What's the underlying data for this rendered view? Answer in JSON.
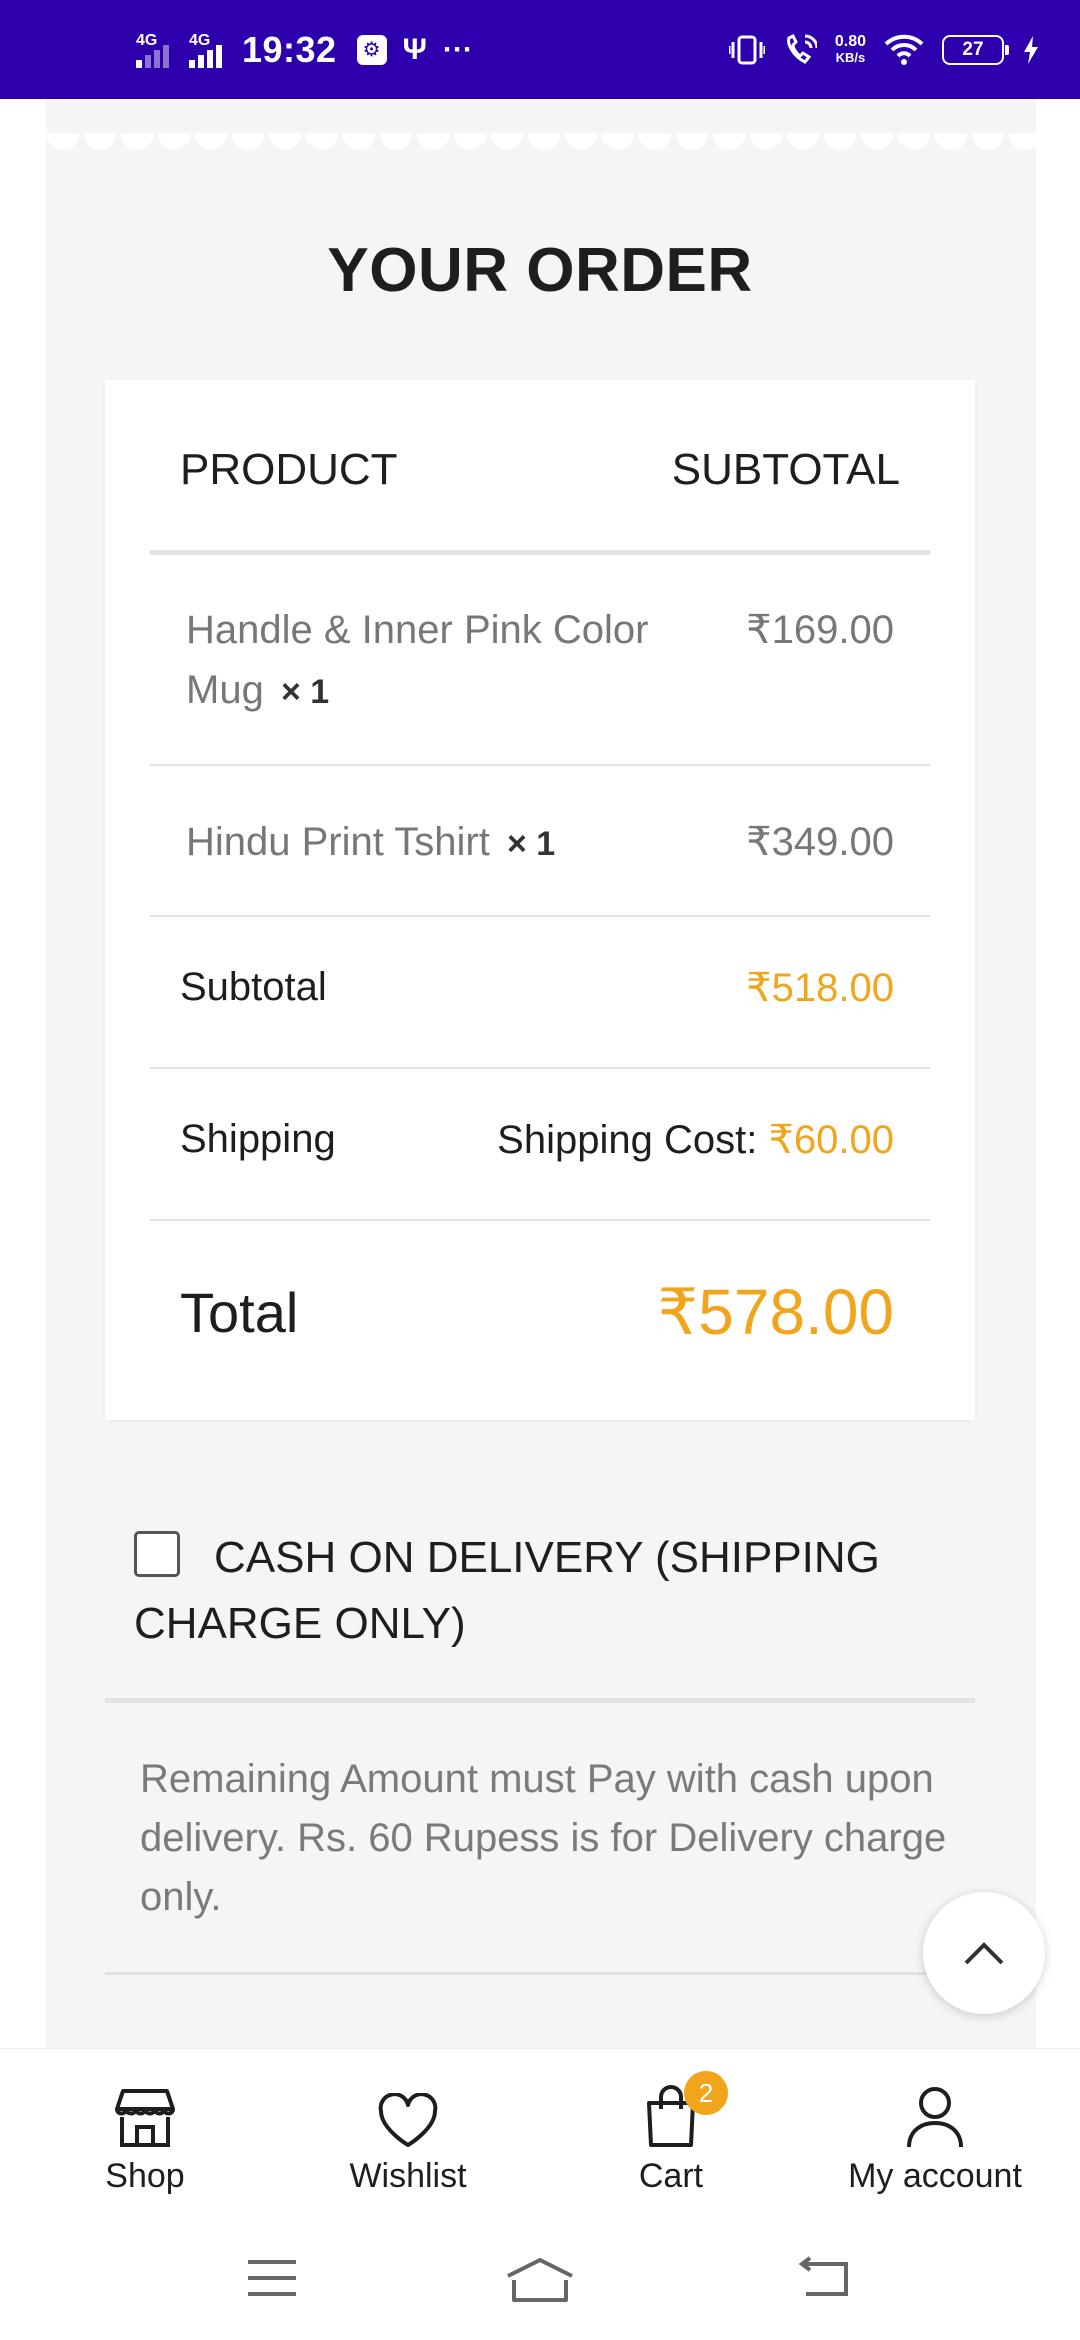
{
  "status_bar": {
    "signal1": "4G",
    "signal2": "4G",
    "time": "19:32",
    "speed_value": "0.80",
    "speed_unit": "KB/s",
    "battery": "27"
  },
  "order": {
    "title": "YOUR ORDER",
    "col_product": "PRODUCT",
    "col_subtotal": "SUBTOTAL",
    "items": [
      {
        "name": "Handle & Inner Pink Color Mug",
        "qty": "× 1",
        "price": "₹169.00"
      },
      {
        "name": "Hindu Print Tshirt",
        "qty": "× 1",
        "price": "₹349.00"
      }
    ],
    "subtotal_label": "Subtotal",
    "subtotal_value": "₹518.00",
    "shipping_label": "Shipping",
    "shipping_text": "Shipping Cost: ",
    "shipping_value": "₹60.00",
    "total_label": "Total",
    "total_value": "₹578.00"
  },
  "payment": {
    "option_label": "CASH ON DELIVERY (SHIPPING CHARGE ONLY)",
    "description": "Remaining Amount must Pay with cash upon delivery. Rs. 60 Rupess is for Delivery charge only."
  },
  "bottom_nav": {
    "shop": "Shop",
    "wishlist": "Wishlist",
    "cart": "Cart",
    "cart_count": "2",
    "account": "My account"
  },
  "colors": {
    "status_bar": "#2e00ad",
    "accent": "#f0a51c",
    "panel": "#f5f5f5"
  }
}
